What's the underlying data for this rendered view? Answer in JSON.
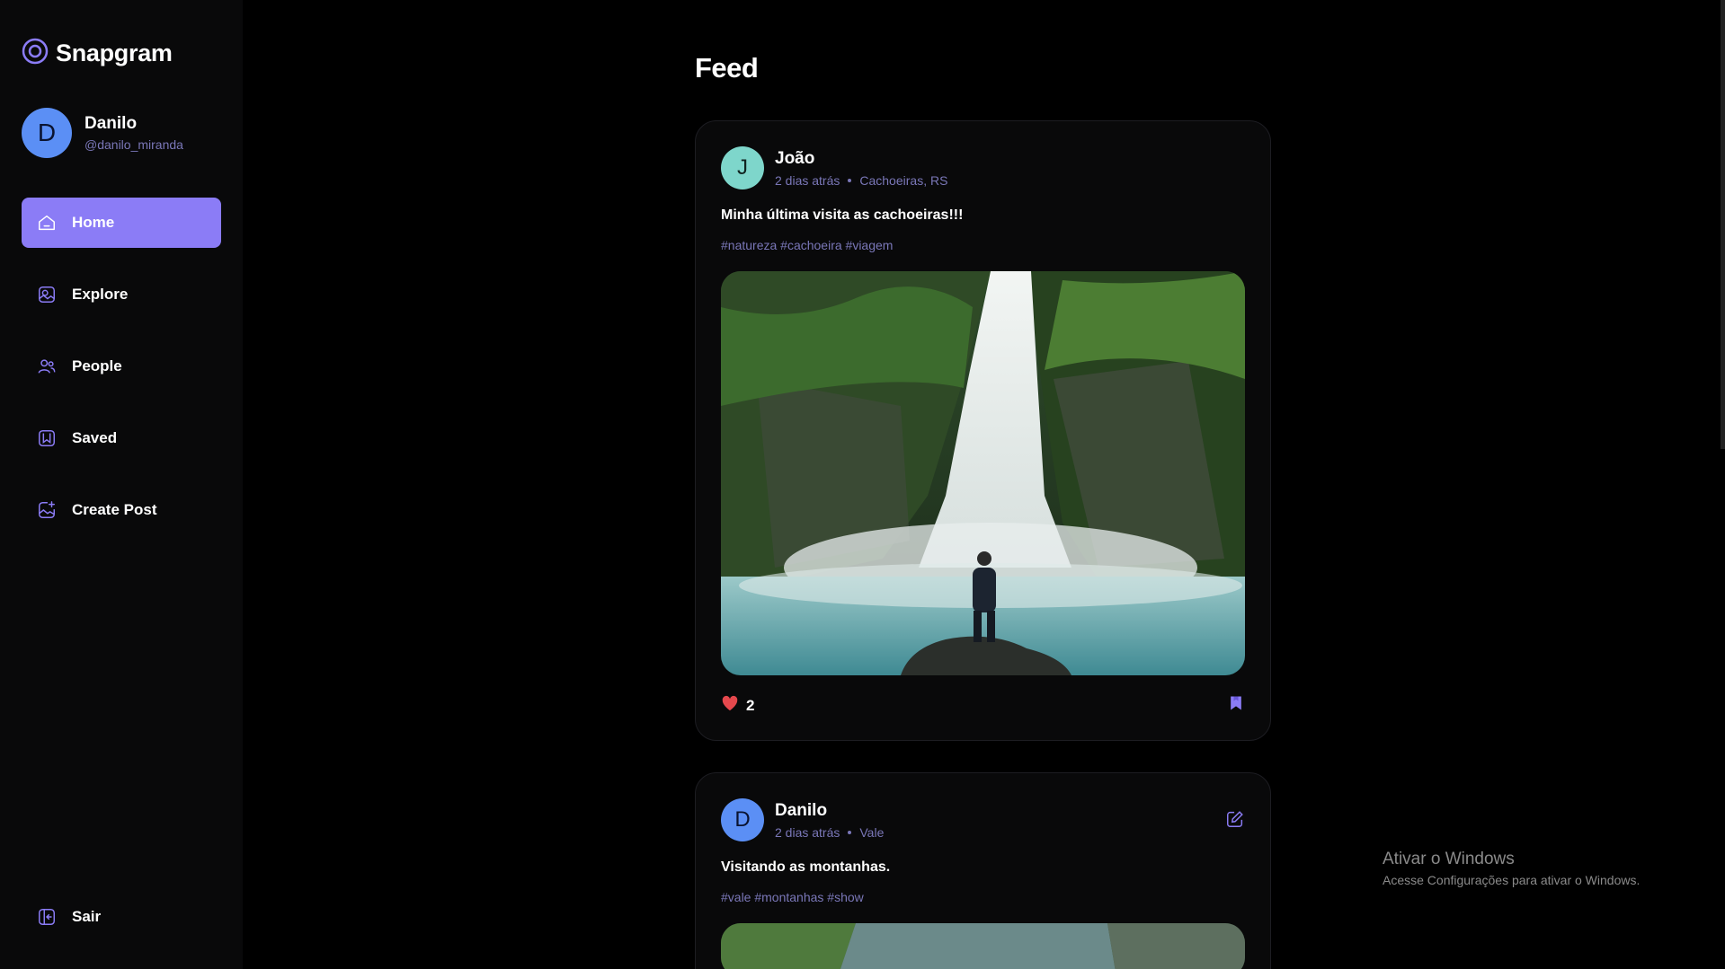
{
  "app": {
    "name": "Snapgram",
    "accent": "#8b7cf6"
  },
  "user": {
    "initial": "D",
    "name": "Danilo",
    "handle": "@danilo_miranda"
  },
  "nav": [
    {
      "label": "Home",
      "icon": "home-icon",
      "active": true
    },
    {
      "label": "Explore",
      "icon": "explore-icon",
      "active": false
    },
    {
      "label": "People",
      "icon": "people-icon",
      "active": false
    },
    {
      "label": "Saved",
      "icon": "saved-icon",
      "active": false
    },
    {
      "label": "Create Post",
      "icon": "create-post-icon",
      "active": false
    }
  ],
  "logout_label": "Sair",
  "feed": {
    "title": "Feed",
    "posts": [
      {
        "author_initial": "J",
        "author": "João",
        "time": "2 dias atrás",
        "location": "Cachoeiras, RS",
        "caption": "Minha última visita as cachoeiras!!!",
        "tags": "#natureza #cachoeira #viagem",
        "likes": "2",
        "image": "waterfall-photo"
      },
      {
        "author_initial": "D",
        "author": "Danilo",
        "time": "2 dias atrás",
        "location": "Vale",
        "caption": "Visitando as montanhas.",
        "tags": "#vale #montanhas #show",
        "image": "mountain-photo"
      }
    ]
  },
  "watermark": {
    "title": "Ativar o Windows",
    "subtitle": "Acesse Configurações para ativar o Windows."
  }
}
